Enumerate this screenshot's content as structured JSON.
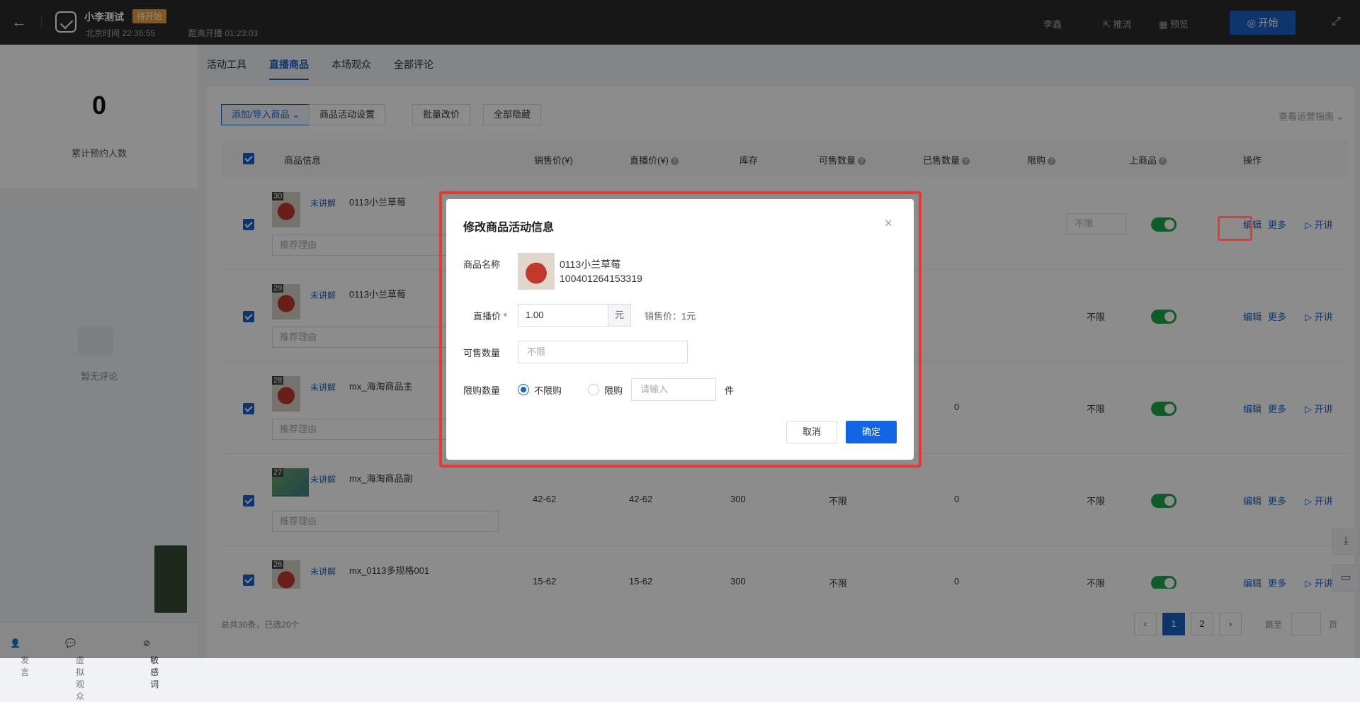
{
  "header": {
    "title": "小李测试",
    "status": "待开始",
    "beijing_time": "北京时间 22:36:55",
    "countdown": "距离开播 01:23:03",
    "user": "李鑫",
    "push": "推流",
    "preview": "预览",
    "start": "开始"
  },
  "left": {
    "count": "0",
    "count_label": "累计预约人数",
    "empty_text": "暂无评论",
    "bottom": {
      "speak": "发言",
      "virtual": "虚拟观众",
      "sensitive": "敏感词"
    }
  },
  "tabs": [
    "活动工具",
    "直播商品",
    "本场观众",
    "全部评论"
  ],
  "toolbar": {
    "add_import": "添加/导入商品",
    "activity_settings": "商品活动设置",
    "batch_price": "批量改价",
    "hide_all": "全部隐藏",
    "guide": "查看运营指南"
  },
  "table": {
    "headers": [
      "商品信息",
      "销售价(¥)",
      "直播价(¥)",
      "库存",
      "可售数量",
      "已售数量",
      "限购",
      "上商品",
      "操作"
    ],
    "rows": [
      {
        "idx": "30",
        "tag": "未讲解",
        "name": "0113小兰草莓",
        "reason_placeholder": "推荐理由",
        "sale": "",
        "live": "",
        "stock": "",
        "avail": "",
        "sold": "",
        "limit": "不限",
        "edit": "编辑",
        "more": "更多",
        "explain": "开讲"
      },
      {
        "idx": "29",
        "tag": "未讲解",
        "name": "0113小兰草莓",
        "reason_placeholder": "推荐理由",
        "sale": "",
        "live": "",
        "stock": "",
        "avail": "",
        "sold": "",
        "limit": "不限",
        "edit": "编辑",
        "more": "更多",
        "explain": "开讲"
      },
      {
        "idx": "28",
        "tag": "未讲解",
        "name": "mx_海淘商品主",
        "reason_placeholder": "推荐理由",
        "sale": "",
        "live": "",
        "stock": "",
        "avail": "",
        "sold": "0",
        "limit": "不限",
        "edit": "编辑",
        "more": "更多",
        "explain": "开讲"
      },
      {
        "idx": "27",
        "tag": "未讲解",
        "name": "mx_海淘商品副",
        "reason_placeholder": "推荐理由",
        "sale": "42-62",
        "live": "42-62",
        "stock": "300",
        "avail": "不限",
        "sold": "0",
        "limit": "不限",
        "edit": "编辑",
        "more": "更多",
        "explain": "开讲"
      },
      {
        "idx": "26",
        "tag": "未讲解",
        "name": "mx_0113多规格001",
        "reason_placeholder": "推荐理由",
        "sale": "15-62",
        "live": "15-62",
        "stock": "300",
        "avail": "不限",
        "sold": "0",
        "limit": "不限",
        "edit": "编辑",
        "more": "更多",
        "explain": "开讲"
      }
    ]
  },
  "footer": {
    "summary": "总共30条，已选20个",
    "pages": [
      "1",
      "2"
    ],
    "jump_to": "跳至",
    "page_unit": "页"
  },
  "modal": {
    "title": "修改商品活动信息",
    "product_label": "商品名称",
    "product_name": "0113小兰草莓",
    "product_id": "100401264153319",
    "live_price_label": "直播价",
    "live_price_value": "1.00",
    "currency_unit": "元",
    "sale_price": "销售价：1元",
    "qty_label": "可售数量",
    "qty_placeholder": "不限",
    "limit_label": "限购数量",
    "option_unlimited": "不限购",
    "option_limited": "限购",
    "limit_placeholder": "请输入",
    "piece_unit": "件",
    "cancel": "取消",
    "confirm": "确定"
  }
}
